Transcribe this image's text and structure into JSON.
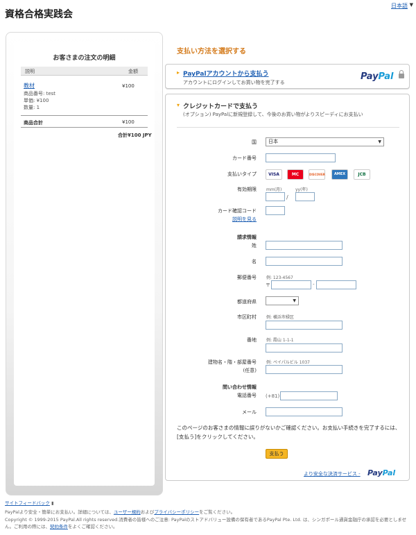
{
  "header": {
    "merchant": "資格合格実践会",
    "language": "日本語"
  },
  "summary": {
    "title": "お客さまの注文の明細",
    "col_desc": "説明",
    "col_amount": "金額",
    "item": {
      "name": "教材",
      "line1": "商品番号: test",
      "line2": "単価: ¥100",
      "line3": "数量: 1",
      "amount": "¥100"
    },
    "subtotal_label": "商品合計",
    "subtotal_value": "¥100",
    "total": "合計¥100 JPY"
  },
  "main": {
    "choose_title": "支払い方法を選択する",
    "paypal_option": {
      "link": "PayPalアカウントから支払う",
      "sub": "アカウントにログインしてお買い物を完了する",
      "logo_a": "Pay",
      "logo_b": "Pal"
    },
    "card_option": {
      "title": "クレジットカードで支払う",
      "sub": "(オプション) PayPalに新規登録して、今後のお買い物がよりスピーディにお支払い"
    }
  },
  "form": {
    "country_label": "国",
    "country_value": "日本",
    "card_number_label": "カード番号",
    "payment_type_label": "支払いタイプ",
    "cards": [
      "VISA",
      "MC",
      "DISCOVER",
      "AMEX",
      "JCB"
    ],
    "expiry_label": "有効期限",
    "expiry_month_hint": "mm(月)",
    "expiry_year_hint": "yy(年)",
    "expiry_sep": "/",
    "cvv_label": "カード確認コード",
    "cvv_help": "説明を見る",
    "billing_title": "請求情報",
    "last_name_label": "姓",
    "first_name_label": "名",
    "postal_label": "郵便番号",
    "postal_hint": "例: 123-4567",
    "postal_prefix": "〒",
    "postal_sep": "-",
    "prefecture_label": "都道府県",
    "city_label": "市区町村",
    "city_hint": "例: 横浜市緑区",
    "address_label": "番地",
    "address_hint": "例: 霞山 1-1-1",
    "building_label": "建物名・階・部屋番号",
    "building_optional": "(任意)",
    "building_hint": "例: ペイパルビル 1037",
    "contact_title": "問い合わせ情報",
    "phone_label": "電話番号",
    "phone_prefix": "(+81)",
    "email_label": "メール",
    "note": "このページのお客さまの情報に誤りがないかご確認ください。お支払い手続きを完了するには、[支払う]をクリックしてください。",
    "pay_button": "支払う",
    "safer_link": "より安全な決済サービス -",
    "safer_logo_a": "Pay",
    "safer_logo_b": "Pal"
  },
  "footer": {
    "feedback": "サイトフィードバック",
    "feedback_mark": "▮",
    "line1_a": "PayPalより安全・簡単にお支払い。詳細については、",
    "terms": "ユーザー規約",
    "line1_b": "および",
    "privacy": "プライバシーポリシー",
    "line1_c": "をご覧ください。",
    "line2": "Copyright © 1999-2015 PayPal.All rights reserved.消費者の皆様へのご注意: PayPalのストアドバリュー設備の保有者であるPayPal Pte. Ltd. は、シンガポール通貨金融庁の承認を必要としません。ご利用の際には、",
    "line2_link": "契約条件",
    "line2_end": "をよくご確認ください。"
  }
}
